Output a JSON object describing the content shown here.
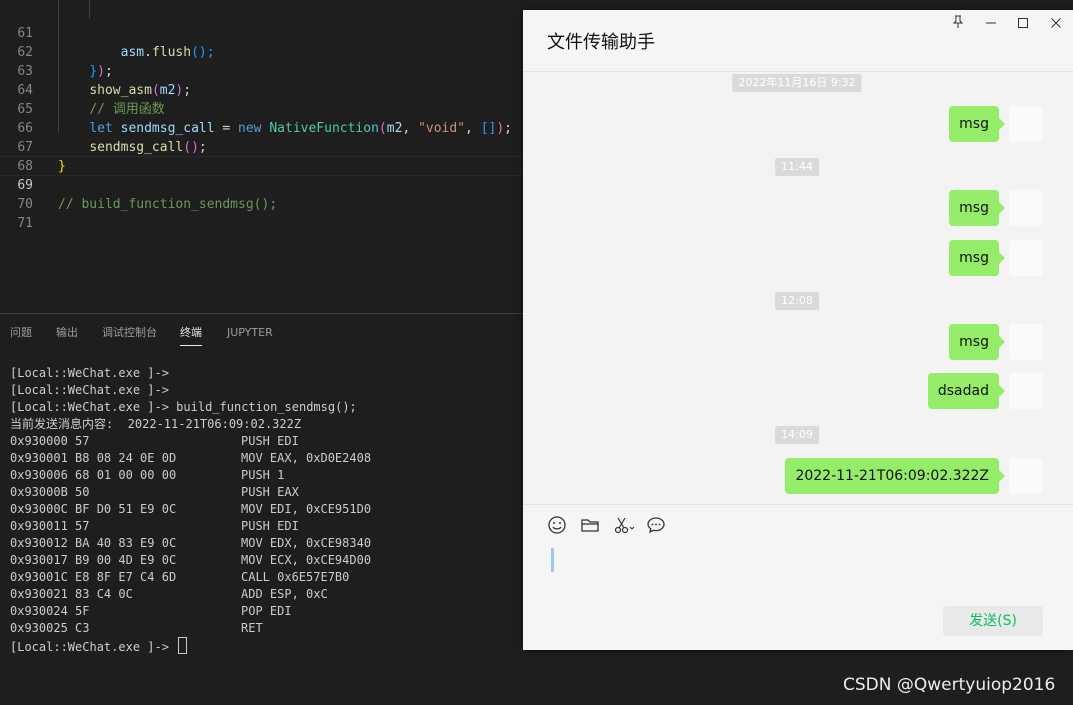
{
  "editor": {
    "lines": [
      {
        "n": "61",
        "tokens": [
          {
            "t": "        ",
            "c": ""
          },
          {
            "t": "asm",
            "c": "t-var"
          },
          {
            "t": ".",
            "c": ""
          },
          {
            "t": "flush",
            "c": "t-fn"
          },
          {
            "t": "();",
            "c": "t-br3"
          }
        ]
      },
      {
        "n": "62",
        "tokens": [
          {
            "t": "    ",
            "c": ""
          },
          {
            "t": "}",
            "c": "t-br3"
          },
          {
            "t": ")",
            "c": "t-br2"
          },
          {
            "t": ";",
            "c": ""
          }
        ]
      },
      {
        "n": "63",
        "tokens": [
          {
            "t": "    ",
            "c": ""
          },
          {
            "t": "show_asm",
            "c": "t-fn"
          },
          {
            "t": "(",
            "c": "t-br2"
          },
          {
            "t": "m2",
            "c": "t-var"
          },
          {
            "t": ")",
            "c": "t-br2"
          },
          {
            "t": ";",
            "c": ""
          }
        ]
      },
      {
        "n": "64",
        "tokens": [
          {
            "t": "    ",
            "c": ""
          },
          {
            "t": "// 调用函数",
            "c": "t-com"
          }
        ]
      },
      {
        "n": "65",
        "tokens": [
          {
            "t": "    ",
            "c": ""
          },
          {
            "t": "let",
            "c": "t-kw"
          },
          {
            "t": " ",
            "c": ""
          },
          {
            "t": "sendmsg_call",
            "c": "t-var"
          },
          {
            "t": " = ",
            "c": ""
          },
          {
            "t": "new",
            "c": "t-kw"
          },
          {
            "t": " ",
            "c": ""
          },
          {
            "t": "NativeFunction",
            "c": "t-cls"
          },
          {
            "t": "(",
            "c": "t-br2"
          },
          {
            "t": "m2",
            "c": "t-var"
          },
          {
            "t": ", ",
            "c": ""
          },
          {
            "t": "\"void\"",
            "c": "t-str"
          },
          {
            "t": ", ",
            "c": ""
          },
          {
            "t": "[]",
            "c": "t-br3"
          },
          {
            "t": ")",
            "c": "t-br2"
          },
          {
            "t": ";",
            "c": ""
          }
        ]
      },
      {
        "n": "66",
        "tokens": [
          {
            "t": "    ",
            "c": ""
          },
          {
            "t": "sendmsg_call",
            "c": "t-fn"
          },
          {
            "t": "(",
            "c": "t-br2"
          },
          {
            "t": ")",
            "c": "t-br2"
          },
          {
            "t": ";",
            "c": ""
          }
        ]
      },
      {
        "n": "67",
        "tokens": [
          {
            "t": "}",
            "c": "t-br1"
          }
        ]
      },
      {
        "n": "68",
        "tokens": []
      },
      {
        "n": "69",
        "tokens": [
          {
            "t": "// build_function_sendmsg();",
            "c": "t-com"
          }
        ],
        "current": true
      },
      {
        "n": "70",
        "tokens": []
      },
      {
        "n": "71",
        "tokens": []
      }
    ]
  },
  "panel": {
    "tabs": [
      {
        "label": "问题",
        "active": false
      },
      {
        "label": "输出",
        "active": false
      },
      {
        "label": "调试控制台",
        "active": false
      },
      {
        "label": "终端",
        "active": true
      },
      {
        "label": "JUPYTER",
        "active": false
      }
    ],
    "terminal": {
      "prompts": [
        "[Local::WeChat.exe ]->",
        "[Local::WeChat.exe ]->",
        "[Local::WeChat.exe ]-> build_function_sendmsg();"
      ],
      "message_line": "当前发送消息内容:  2022-11-21T06:09:02.322Z",
      "asm": [
        {
          "addr": "0x930000 57",
          "instr": "PUSH EDI"
        },
        {
          "addr": "0x930001 B8 08 24 0E 0D",
          "instr": "MOV EAX, 0xD0E2408"
        },
        {
          "addr": "0x930006 68 01 00 00 00",
          "instr": "PUSH 1"
        },
        {
          "addr": "0x93000B 50",
          "instr": "PUSH EAX"
        },
        {
          "addr": "0x93000C BF D0 51 E9 0C",
          "instr": "MOV EDI, 0xCE951D0"
        },
        {
          "addr": "0x930011 57",
          "instr": "PUSH EDI"
        },
        {
          "addr": "0x930012 BA 40 83 E9 0C",
          "instr": "MOV EDX, 0xCE98340"
        },
        {
          "addr": "0x930017 B9 00 4D E9 0C",
          "instr": "MOV ECX, 0xCE94D00"
        },
        {
          "addr": "0x93001C E8 8F E7 C4 6D",
          "instr": "CALL 0x6E57E7B0"
        },
        {
          "addr": "0x930021 83 C4 0C",
          "instr": "ADD ESP, 0xC"
        },
        {
          "addr": "0x930024 5F",
          "instr": "POP EDI"
        },
        {
          "addr": "0x930025 C3",
          "instr": "RET"
        }
      ],
      "final_prompt": "[Local::WeChat.exe ]->"
    }
  },
  "wechat": {
    "title": "文件传输助手",
    "window_buttons": {
      "pin": "pin-icon",
      "minimize": "minimize-icon",
      "maximize": "maximize-icon",
      "close": "close-icon"
    },
    "timestamps": [
      "2022年11月16日 9:32",
      "11:44",
      "12:08",
      "14:09"
    ],
    "messages": [
      "msg",
      "msg",
      "msg",
      "msg",
      "dsadad",
      "2022-11-21T06:09:02.322Z"
    ],
    "toolbar": [
      "emoji-icon",
      "folder-icon",
      "scissors-icon",
      "chat-bubble-icon"
    ],
    "send_label": "发送(S)",
    "accent_color": "#95ec69",
    "send_color": "#07c160"
  },
  "watermark": "CSDN @Qwertyuiop2016"
}
